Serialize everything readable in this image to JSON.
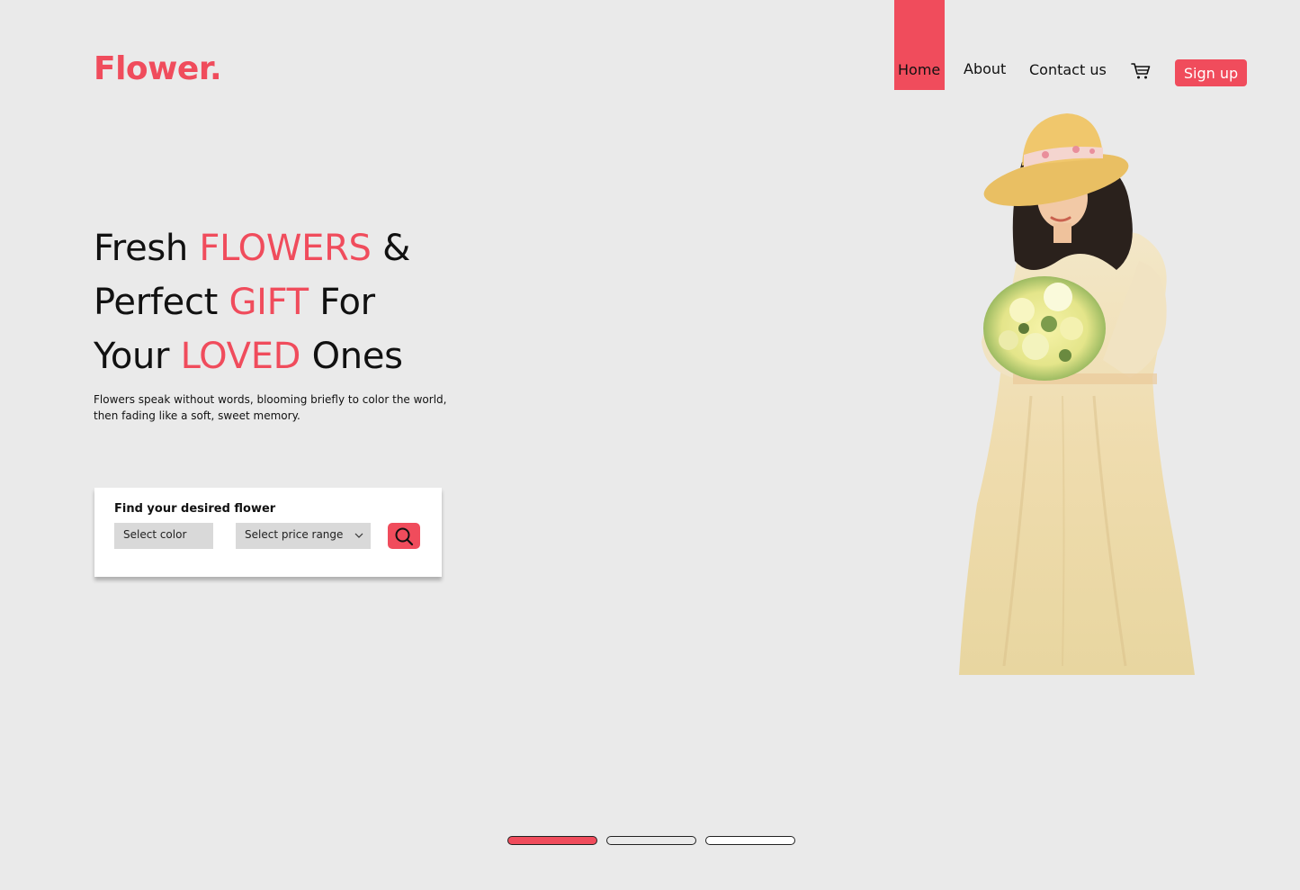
{
  "brand": {
    "name": "Flower.",
    "color": "#f04c5c"
  },
  "nav": {
    "items": [
      {
        "label": "Home",
        "active": true
      },
      {
        "label": "About",
        "active": false
      },
      {
        "label": "Contact us",
        "active": false
      }
    ],
    "cart_icon": "cart-icon",
    "signup_label": "Sign up"
  },
  "hero": {
    "line1": {
      "a": "Fresh ",
      "accent": "FLOWERS",
      "b": " &"
    },
    "line2": {
      "a": "Perfect ",
      "accent": "GIFT",
      "b": " For"
    },
    "line3": {
      "a": "Your ",
      "accent": "LOVED",
      "b": " Ones"
    },
    "description": "Flowers speak without words, blooming briefly to color the world, then fading like a soft, sweet memory."
  },
  "search": {
    "title": "Find your desired flower",
    "color_placeholder": "Select color",
    "price_placeholder": "Select price range",
    "search_icon": "search-icon"
  },
  "carousel": {
    "slides": 3,
    "active_index": 0
  },
  "colors": {
    "accent": "#f04c5c",
    "background": "#eaeaea"
  }
}
